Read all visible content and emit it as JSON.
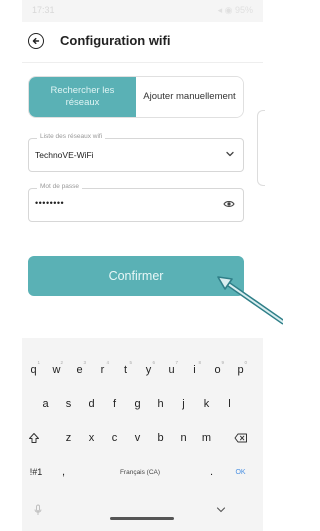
{
  "header": {
    "title": "Configuration wifi"
  },
  "status_bar": {
    "time": "17:31",
    "right": "◂ ◉ 95%"
  },
  "segmented": {
    "search_label": "Rechercher les réseaux",
    "manual_label": "Ajouter manuellement"
  },
  "wifi_field": {
    "label": "Liste des réseaux wifi",
    "value": "TechnoVE-WiFi"
  },
  "password_field": {
    "label": "Mot de passe",
    "value": "••••••••"
  },
  "confirm": {
    "label": "Confirmer"
  },
  "keyboard": {
    "row1": [
      "q",
      "w",
      "e",
      "r",
      "t",
      "y",
      "u",
      "i",
      "o",
      "p"
    ],
    "row1_hints": [
      "1",
      "2",
      "3",
      "4",
      "5",
      "6",
      "7",
      "8",
      "9",
      "0"
    ],
    "row2": [
      "a",
      "s",
      "d",
      "f",
      "g",
      "h",
      "j",
      "k",
      "l"
    ],
    "row3": [
      "z",
      "x",
      "c",
      "v",
      "b",
      "n",
      "m"
    ],
    "symbols_key": "!#1",
    "comma_key": ",",
    "space_label": "Français (CA)",
    "period_key": ".",
    "ok_key": "OK"
  },
  "colors": {
    "accent": "#5ab1b5",
    "annotation_arrow": "#2f7f88"
  }
}
